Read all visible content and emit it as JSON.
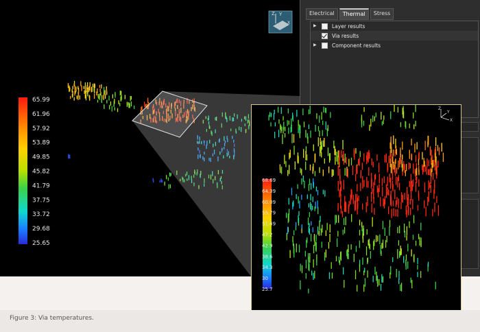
{
  "tabs": [
    {
      "label": "Electrical",
      "active": false
    },
    {
      "label": "Thermal",
      "active": true
    },
    {
      "label": "Stress",
      "active": false
    }
  ],
  "tree": [
    {
      "label": "Layer results",
      "checked": false,
      "expandable": true
    },
    {
      "label": "Via results",
      "checked": true,
      "expandable": false
    },
    {
      "label": "Component results",
      "checked": false,
      "expandable": true
    }
  ],
  "legend_main": [
    "65.99",
    "61.96",
    "57.92",
    "53.89",
    "49.85",
    "45.82",
    "41.79",
    "37.75",
    "33.72",
    "29.68",
    "25.65"
  ],
  "legend_inset": [
    "68.69",
    "64.39",
    "60.09",
    "55.79",
    "51.49",
    "47.2",
    "42.9",
    "38.6",
    "34.3",
    "30",
    "25.7"
  ],
  "axis": {
    "z": "Z",
    "y": "Y",
    "x": "X"
  },
  "colors": {
    "hot": "#e0382a",
    "warm": "#f2a12a",
    "mid": "#9fd63a",
    "cool": "#2bd4c8",
    "cold": "#2a48e8",
    "inset_border": "#d9c98a"
  },
  "caption": "Figure 3: Via temperatures."
}
